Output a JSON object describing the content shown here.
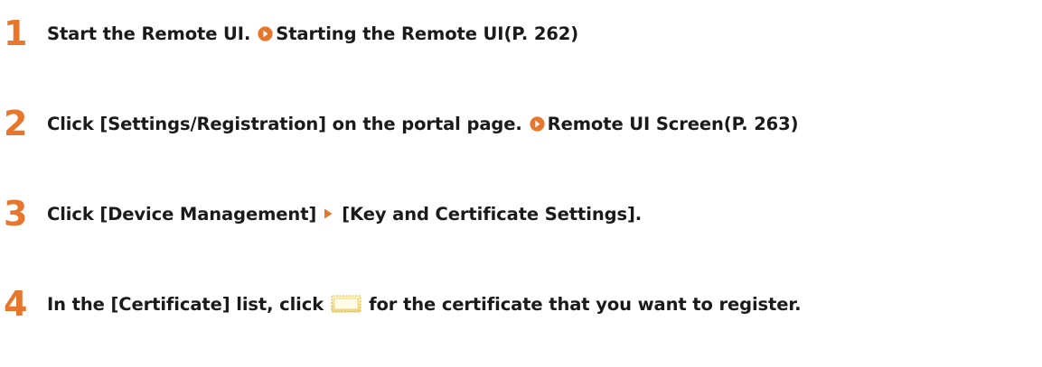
{
  "steps": [
    {
      "number": "1",
      "text": "Start the Remote UI.",
      "link_label": "Starting the Remote UI(P. 262)",
      "link_icon": "circle-arrow-icon"
    },
    {
      "number": "2",
      "text": "Click [Settings/Registration] on the portal page.",
      "link_label": "Remote UI Screen(P. 263)",
      "link_icon": "circle-arrow-icon"
    },
    {
      "number": "3",
      "text_before": "Click [Device Management]",
      "separator_icon": "triangle-arrow-icon",
      "text_after": "[Key and Certificate Settings]."
    },
    {
      "number": "4",
      "text_before": "In the [Certificate] list, click",
      "inline_icon": "certificate-icon",
      "text_after": "for the certificate that you want to register."
    }
  ],
  "colors": {
    "step_number": "#e8772e",
    "link_icon": "#e8772e",
    "text": "#1a1a1a"
  }
}
